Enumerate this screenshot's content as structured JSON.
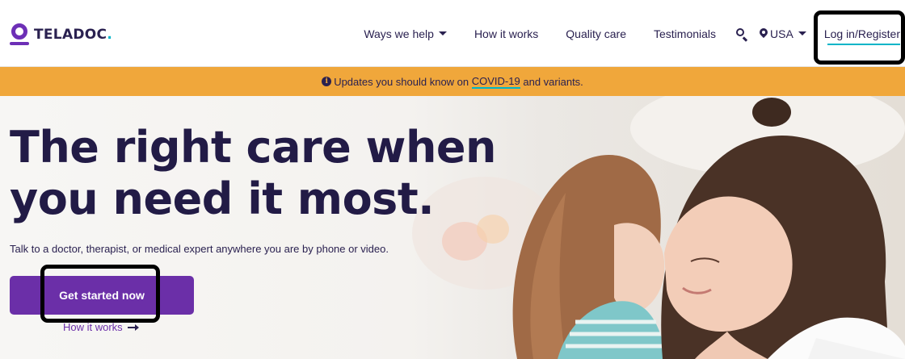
{
  "brand": {
    "name": "TELADOC",
    "dot": "."
  },
  "nav": {
    "items": [
      {
        "label": "Ways we help",
        "has_dropdown": true
      },
      {
        "label": "How it works",
        "has_dropdown": false
      },
      {
        "label": "Quality care",
        "has_dropdown": false
      },
      {
        "label": "Testimonials",
        "has_dropdown": false
      }
    ],
    "search_icon": "search-icon",
    "locale": "USA",
    "login": "Log in/Register"
  },
  "banner": {
    "icon": "info-icon",
    "text_before": "Updates you should know on ",
    "link": "COVID-19",
    "text_after": " and variants."
  },
  "hero": {
    "title": "The right care when you need it most.",
    "subtitle": "Talk to a doctor, therapist, or medical expert anywhere you are by phone or video.",
    "cta": "Get started now",
    "secondary_link": "How it works"
  },
  "colors": {
    "brand_purple": "#6b2fa8",
    "heading_navy": "#221b46",
    "banner_orange": "#f0a73b",
    "accent_teal": "#00b5c8"
  }
}
